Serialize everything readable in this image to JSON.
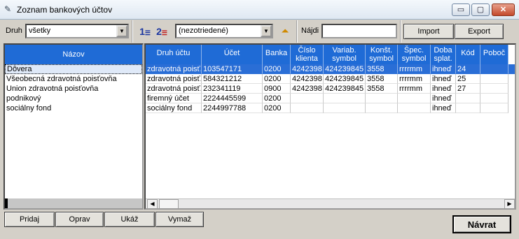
{
  "window": {
    "title": "Zoznam bankových účtov",
    "controls": {
      "minimize": "▭",
      "maximize": "▢",
      "close": "✕"
    }
  },
  "toolbar": {
    "druh_label": "Druh",
    "druh_value": "všetky",
    "sort_asc_icon": "1",
    "sort_desc_icon": "2",
    "sort_value": "(nezotriedené)",
    "find_label": "Nájdi",
    "find_value": "",
    "import_label": "Import",
    "export_label": "Export"
  },
  "left_list": {
    "header": "Názov",
    "items": [
      {
        "label": "Dôvera",
        "selected": true
      },
      {
        "label": "Všeobecná zdravotná poisťovňa"
      },
      {
        "label": "Union zdravotná poisťovňa"
      },
      {
        "label": "podnikový"
      },
      {
        "label": "sociálny fond"
      }
    ]
  },
  "grid": {
    "columns": [
      {
        "l1": "Druh účtu",
        "l2": ""
      },
      {
        "l1": "Účet",
        "l2": ""
      },
      {
        "l1": "Banka",
        "l2": ""
      },
      {
        "l1": "Číslo",
        "l2": "klienta"
      },
      {
        "l1": "Variab.",
        "l2": "symbol"
      },
      {
        "l1": "Konšt.",
        "l2": "symbol"
      },
      {
        "l1": "Špec.",
        "l2": "symbol"
      },
      {
        "l1": "Doba",
        "l2": "splat."
      },
      {
        "l1": "Kód",
        "l2": ""
      },
      {
        "l1": "Poboč",
        "l2": ""
      }
    ],
    "rows": [
      {
        "selected": true,
        "cells": [
          "zdravotná poisť.",
          "103547171",
          "0200",
          "4242398",
          "424239845",
          "3558",
          "rrrrmm",
          "ihneď",
          "24",
          ""
        ]
      },
      {
        "cells": [
          "zdravotná poisť.",
          "584321212",
          "0200",
          "4242398",
          "424239845",
          "3558",
          "rrrrmm",
          "ihneď",
          "25",
          ""
        ]
      },
      {
        "cells": [
          "zdravotná poisť.",
          "232341119",
          "0900",
          "4242398",
          "424239845",
          "3558",
          "rrrrmm",
          "ihneď",
          "27",
          ""
        ]
      },
      {
        "cells": [
          "firemný účet",
          "2224445599",
          "0200",
          "",
          "",
          "",
          "",
          "ihneď",
          "",
          ""
        ]
      },
      {
        "cells": [
          "sociálny fond",
          "2244997788",
          "0200",
          "",
          "",
          "",
          "",
          "ihneď",
          "",
          ""
        ]
      }
    ]
  },
  "bottom": {
    "pridaj": "Pridaj",
    "oprav": "Oprav",
    "ukaz": "Ukáž",
    "vymaz": "Vymaž",
    "navrat": "Návrat"
  },
  "colors": {
    "header_blue": "#1f6bd6",
    "selection_blue": "#2a6ed6"
  }
}
